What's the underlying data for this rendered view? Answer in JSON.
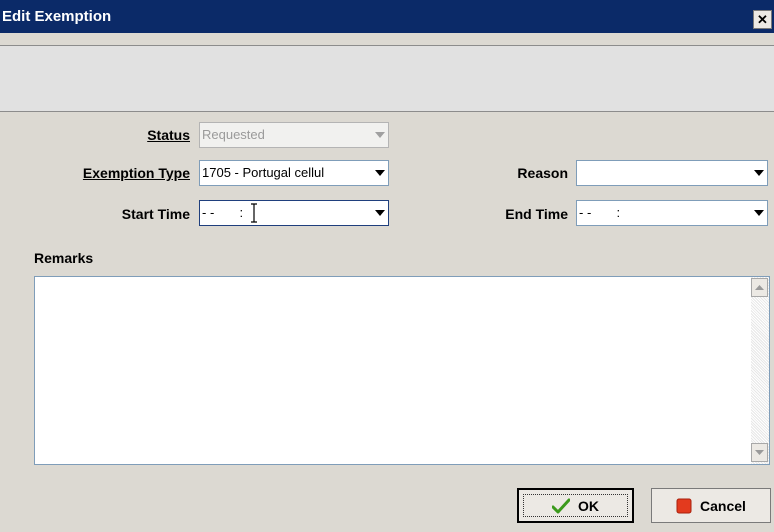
{
  "window": {
    "title": "Edit Exemption",
    "close_glyph": "✕"
  },
  "form": {
    "status": {
      "label": "Status",
      "value": "Requested"
    },
    "exemption_type": {
      "label": "Exemption Type",
      "value": "1705 - Portugal cellul"
    },
    "reason": {
      "label": "Reason",
      "value": ""
    },
    "start_time": {
      "label": "Start Time",
      "value": "- -       :"
    },
    "end_time": {
      "label": "End Time",
      "value": "- -       :"
    },
    "remarks": {
      "label": "Remarks",
      "value": ""
    }
  },
  "buttons": {
    "ok": "OK",
    "cancel": "Cancel"
  },
  "icons": {
    "ok": "checkmark-icon",
    "cancel": "red-square-icon",
    "dropdown": "dropdown-arrow-icon"
  },
  "colors": {
    "titlebar": "#0b2a68",
    "checkmark": "#3b9a1c",
    "cancel_square": "#e33a1e"
  }
}
